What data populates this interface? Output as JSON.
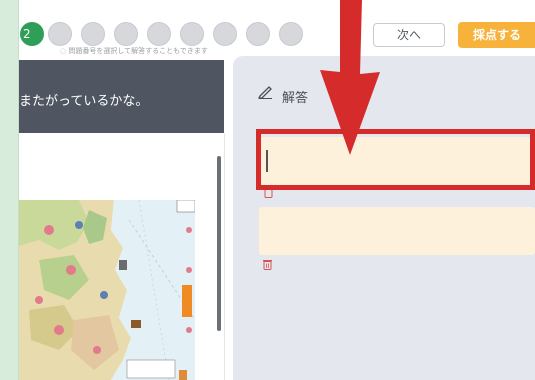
{
  "stepper": {
    "current": "2",
    "hint": "◌ 問題番号を選択して解答することもできます"
  },
  "toolbar": {
    "next_label": "次へ",
    "score_label": "採点する"
  },
  "question": {
    "text": "またがっているかな。"
  },
  "answer": {
    "title": "解答"
  },
  "colors": {
    "accent": "#f7b23b",
    "current_step": "#2f9e57",
    "highlight": "#d52b2b",
    "answer_box": "#fdf1dc"
  }
}
